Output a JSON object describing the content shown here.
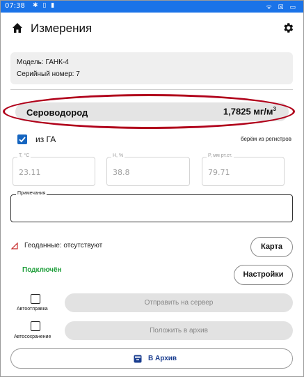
{
  "status_bar": {
    "time": "07:38",
    "left_icons": "✱ ▯ ▮",
    "right_icons": "ᯤ ☒ ▭"
  },
  "header": {
    "title": "Измерения",
    "icons": [
      "home-icon",
      "gear-icon"
    ]
  },
  "device": {
    "model": "Модель: ГАНК-4",
    "serial": "Серийный номер: 7"
  },
  "measurement": {
    "gas": "Сероводород",
    "value": "1,7825 мг/м",
    "unit_sup": "3"
  },
  "from_ga": {
    "label": "из ГА",
    "checked": true,
    "note": "берём из регистров"
  },
  "sensors": [
    {
      "label": "Т, °С",
      "value": "23.11"
    },
    {
      "label": "Н, %",
      "value": "38.8"
    },
    {
      "label": "Р, мм рт.ст.",
      "value": "79.71"
    }
  ],
  "notes": {
    "label": "Примечания",
    "value": ""
  },
  "geo": {
    "text": "Геоданные: отсутствуют",
    "map_button": "Карта"
  },
  "connection": {
    "status": "Подключён",
    "status_color": "#1e9e3a",
    "settings_button": "Настройки"
  },
  "actions": {
    "autosend_label": "Автоотправка",
    "autosend_checked": false,
    "send_button": "Отправить на сервер",
    "autosave_label": "Автосохранение",
    "autosave_checked": false,
    "archive_put_button": "Положить в архив",
    "archive_button": "В Архив"
  },
  "colors": {
    "accent": "#1565c0",
    "highlight_oval": "#b0001a",
    "status_bar": "#1a73e8"
  }
}
